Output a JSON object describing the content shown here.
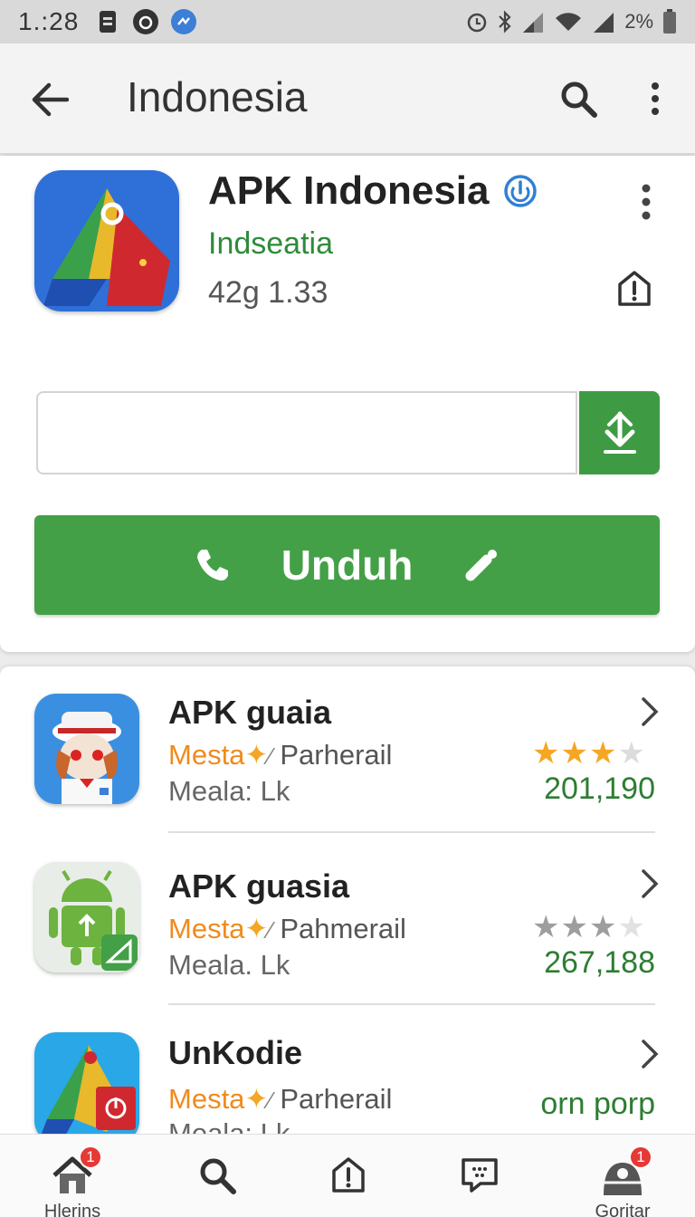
{
  "status_bar": {
    "time": "1.:28",
    "battery": "2%"
  },
  "app_bar": {
    "title": "Indonesia"
  },
  "app": {
    "name": "APK Indonesia",
    "developer": "Indseatia",
    "meta": "42g 1.33",
    "download_field_value": "",
    "download_button_label": "Unduh"
  },
  "list": [
    {
      "title": "APK  guaia",
      "tag": "Mesta",
      "category": "Parherail",
      "meta": "Meala: Lk",
      "rating": 3,
      "rating_color": "#f5a623",
      "count": "201,190"
    },
    {
      "title": "APK guasia",
      "tag": "Mesta",
      "category": "Pahmerail",
      "meta": "Meala. Lk",
      "rating": 3,
      "rating_color": "#9e9e9e",
      "count": "267,188"
    },
    {
      "title": "UnKodie",
      "tag": "Mesta",
      "category": "Parherail",
      "meta": "Meala: Lk",
      "rating": null,
      "rating_color": "",
      "count": "orn porp"
    }
  ],
  "bottom_nav": [
    {
      "label": "Hlerins",
      "icon": "home-icon",
      "badge": "1"
    },
    {
      "label": "",
      "icon": "search-icon",
      "badge": ""
    },
    {
      "label": "",
      "icon": "share-icon",
      "badge": ""
    },
    {
      "label": "",
      "icon": "message-icon",
      "badge": ""
    },
    {
      "label": "Goritar",
      "icon": "account-icon",
      "badge": "1"
    }
  ],
  "colors": {
    "brand_green": "#44a047",
    "accent_orange": "#f08a1d",
    "count_green": "#2e7d32",
    "badge_red": "#e53935"
  }
}
